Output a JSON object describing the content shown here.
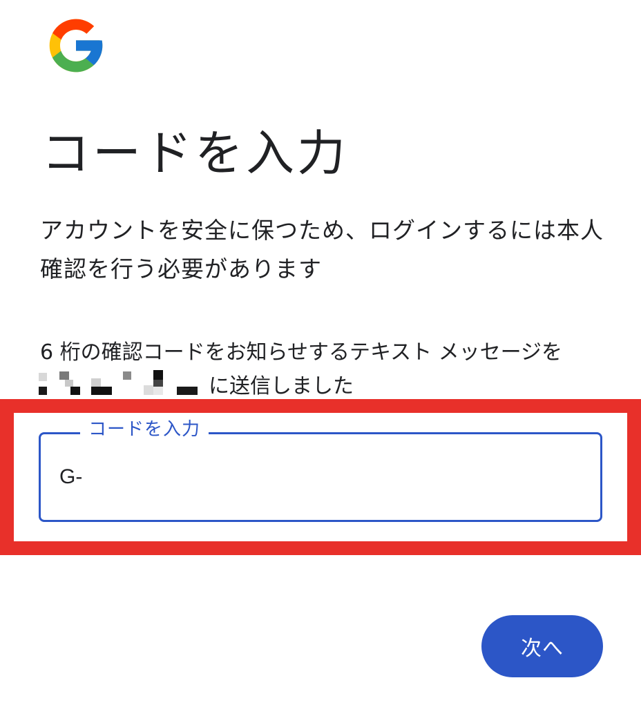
{
  "logo": {
    "icon": "google-g-logo",
    "colors": {
      "red": "#EA4335",
      "yellow": "#FBBC05",
      "green": "#34A853",
      "blue": "#4285F4"
    }
  },
  "title": "コードを入力",
  "description": "アカウントを安全に保つため、ログインするには本人確認を行う必要があります",
  "sms_message": {
    "line1": "6 桁の確認コードをお知らせするテキスト メッセージを",
    "line2_suffix": "に送信しました"
  },
  "code_field": {
    "label": "コードを入力",
    "value": "G-"
  },
  "next_button": {
    "label": "次へ"
  },
  "colors": {
    "accent": "#2C56C7",
    "highlight_frame": "#E8302A",
    "text": "#202124"
  }
}
